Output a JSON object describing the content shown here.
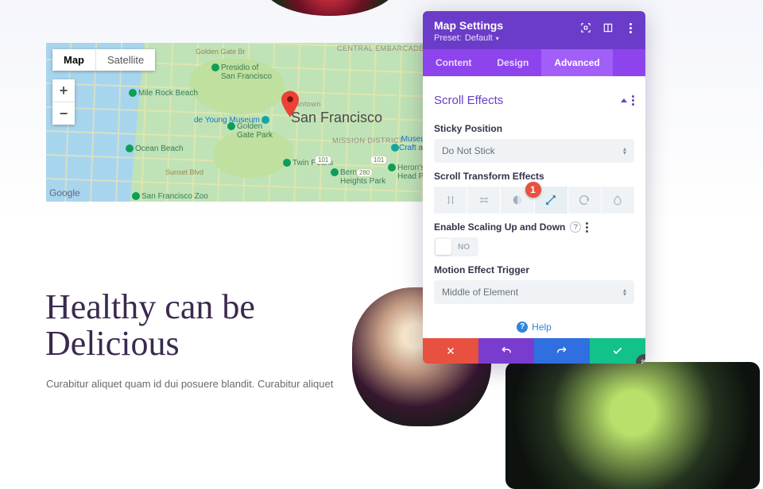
{
  "page": {
    "headline": "Healthy can be Delicious",
    "body": "Curabitur aliquet quam id dui posuere blandit. Curabitur aliquet"
  },
  "map": {
    "type_map": "Map",
    "type_sat": "Satellite",
    "city": "San Francisco",
    "attribution": "Google",
    "pois": {
      "presidio": "Presidio of\nSan Francisco",
      "ggpark": "Golden\nGate Park",
      "milerock": "Mile Rock Beach",
      "oceanbeach": "Ocean Beach",
      "sfzoo": "San Francisco Zoo",
      "deyoung": "de Young Museum",
      "craft": "Museum\nCraft and",
      "japantown": "Japantown",
      "twinpeaks": "Twin Peaks",
      "mission": "Mission\nDistrict",
      "bernal": "Bernal\nHeights Park",
      "embarcadero": "Central\nEmbarcadero\nPiers Historic\nDistrict",
      "sunset": "Sunset Blvd",
      "heronshead": "Heron's\nHead Pa",
      "golden_gate_br": "Golden Gate Br"
    }
  },
  "panel": {
    "title": "Map Settings",
    "preset_label": "Preset:",
    "preset_value": "Default",
    "tabs": {
      "content": "Content",
      "design": "Design",
      "advanced": "Advanced"
    },
    "section": "Scroll Effects",
    "fields": {
      "sticky_label": "Sticky Position",
      "sticky_value": "Do Not Stick",
      "transform_label": "Scroll Transform Effects",
      "scaling_label": "Enable Scaling Up and Down",
      "scaling_value": "NO",
      "trigger_label": "Motion Effect Trigger",
      "trigger_value": "Middle of Element"
    },
    "effect_icons": [
      "vertical-motion",
      "horizontal-motion",
      "fade",
      "scale",
      "rotate",
      "blur"
    ],
    "help": "Help",
    "callout": "1"
  },
  "colors": {
    "brand_purple": "#6b3cc9",
    "tab_purple": "#8e44ec",
    "tab_active": "#a15ff8",
    "danger": "#e8503f",
    "info": "#2f6fe0",
    "success": "#13c18b"
  }
}
